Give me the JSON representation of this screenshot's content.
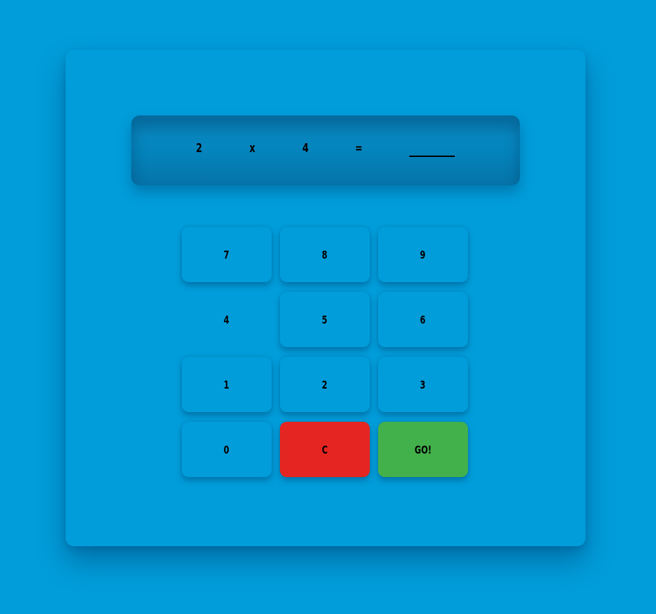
{
  "equation": {
    "operand_a": "2",
    "operator": "x",
    "operand_b": "4",
    "equals": "=",
    "answer": ""
  },
  "keypad": {
    "rows": [
      [
        "7",
        "8",
        "9"
      ],
      [
        "4",
        "5",
        "6"
      ],
      [
        "1",
        "2",
        "3"
      ],
      [
        "0",
        "C",
        "GO!"
      ]
    ],
    "clear_label": "C",
    "go_label": "GO!"
  },
  "colors": {
    "background": "#009dda",
    "clear_button": "#e52521",
    "go_button": "#43b14b"
  }
}
